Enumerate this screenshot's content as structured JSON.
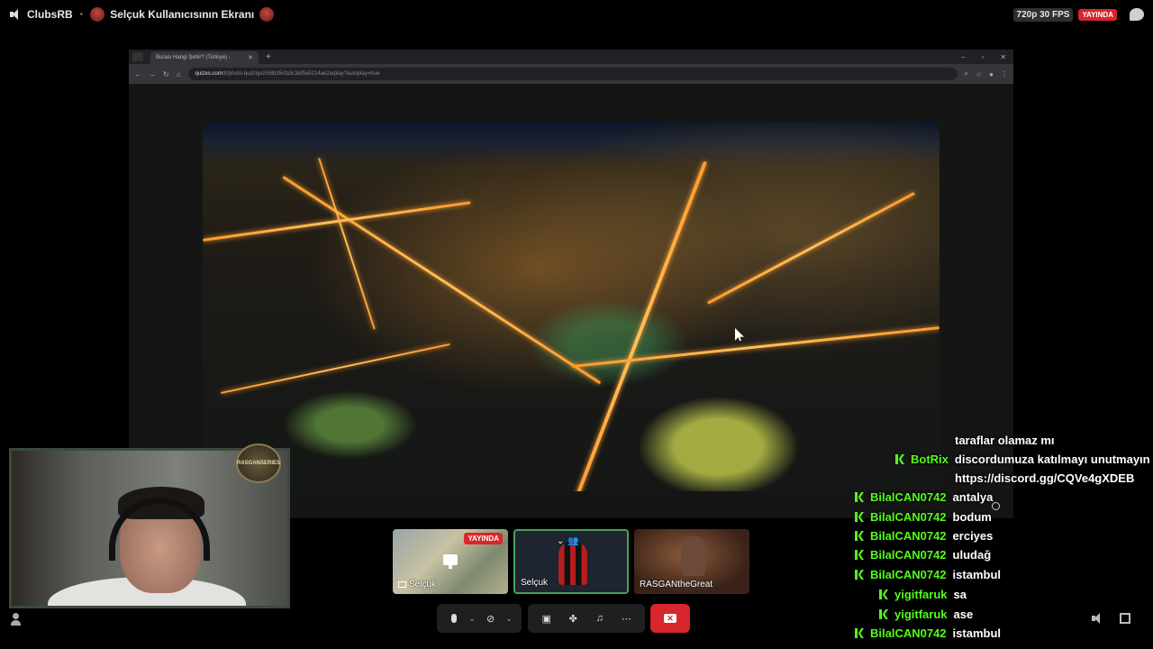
{
  "topbar": {
    "channel": "ClubsRB",
    "stream_title": "Selçuk Kullanıcısının Ekranı",
    "quality": "720p 30 FPS",
    "live_label": "YAYINDA"
  },
  "browser": {
    "tab_title": "Burası Hangi Şehir? (Türkiye) - ",
    "url_domain": "quizes.com",
    "url_path": "/tr/photo-quiz/quiz/68b35cfa3c3ef5a5214ae2a/play?autoplay=true"
  },
  "webcam": {
    "logo_text": "RASGANSERIES"
  },
  "participants": [
    {
      "name": "Selçuk",
      "badge": "YAYINDA"
    },
    {
      "name": "Selçuk"
    },
    {
      "name": "RASGANtheGreat"
    }
  ],
  "chat": [
    {
      "user": "",
      "message": "taraflar olamaz mı"
    },
    {
      "user": "BotRix",
      "message": "discordumuza katılmayı unutmayın"
    },
    {
      "user": "",
      "message": "https://discord.gg/CQVe4gXDEB"
    },
    {
      "user": "BilalCAN0742",
      "message": "antalya"
    },
    {
      "user": "BilalCAN0742",
      "message": "bodum"
    },
    {
      "user": "BilalCAN0742",
      "message": "erciyes"
    },
    {
      "user": "BilalCAN0742",
      "message": "uludağ"
    },
    {
      "user": "BilalCAN0742",
      "message": "istambul"
    },
    {
      "user": "yigitfaruk",
      "message": "sa"
    },
    {
      "user": "yigitfaruk",
      "message": "ase"
    },
    {
      "user": "BilalCAN0742",
      "message": "istambul"
    }
  ],
  "colors": {
    "accent_green": "#53fc18",
    "live_red": "#d9252c",
    "active_tile_border": "#46a35a"
  }
}
